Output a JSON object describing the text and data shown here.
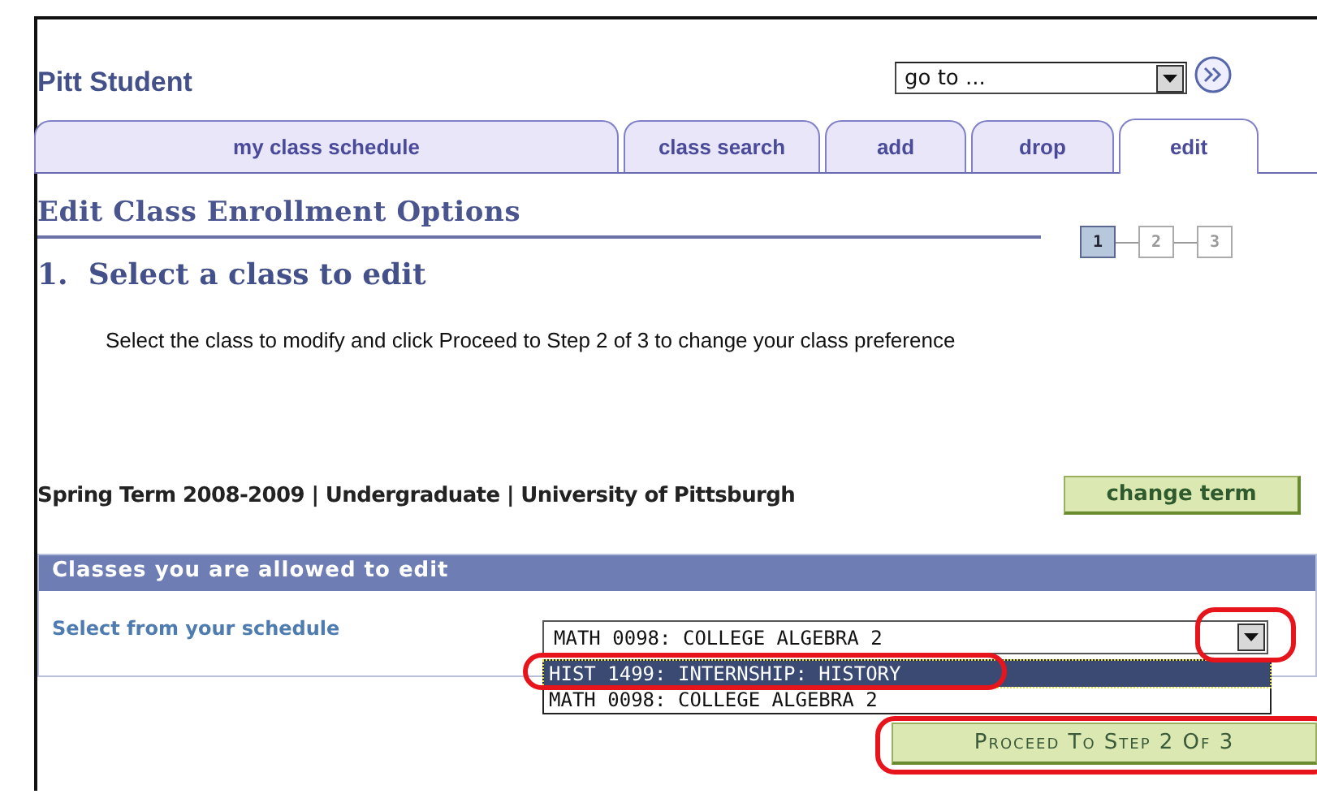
{
  "header": {
    "title": "Pitt Student",
    "goto": {
      "value": "go to ..."
    }
  },
  "tabs": [
    {
      "label": "my class schedule",
      "selected": false
    },
    {
      "label": "class search",
      "selected": false
    },
    {
      "label": "add",
      "selected": false
    },
    {
      "label": "drop",
      "selected": false
    },
    {
      "label": "edit",
      "selected": true
    }
  ],
  "page_title": "Edit Class Enrollment Options",
  "steps": [
    {
      "label": "1",
      "selected": true
    },
    {
      "label": "2",
      "selected": false
    },
    {
      "label": "3",
      "selected": false
    }
  ],
  "step_heading": "1.  Select a class to edit",
  "instructions": "Select the class to modify and click Proceed to Step 2 of 3 to change your class preference",
  "term": {
    "text": "Spring Term 2008-2009 | Undergraduate | University of Pittsburgh",
    "button": "change term"
  },
  "panel": {
    "title": "Classes you are allowed to edit",
    "label": "Select from your schedule",
    "value": "MATH 0098: COLLEGE ALGEBRA 2",
    "options": [
      {
        "label": "HIST 1499: INTERNSHIP: HISTORY",
        "highlighted": true
      },
      {
        "label": "MATH 0098: COLLEGE ALGEBRA 2",
        "highlighted": false
      }
    ]
  },
  "proceed_button": "Proceed To Step 2 Of 3"
}
